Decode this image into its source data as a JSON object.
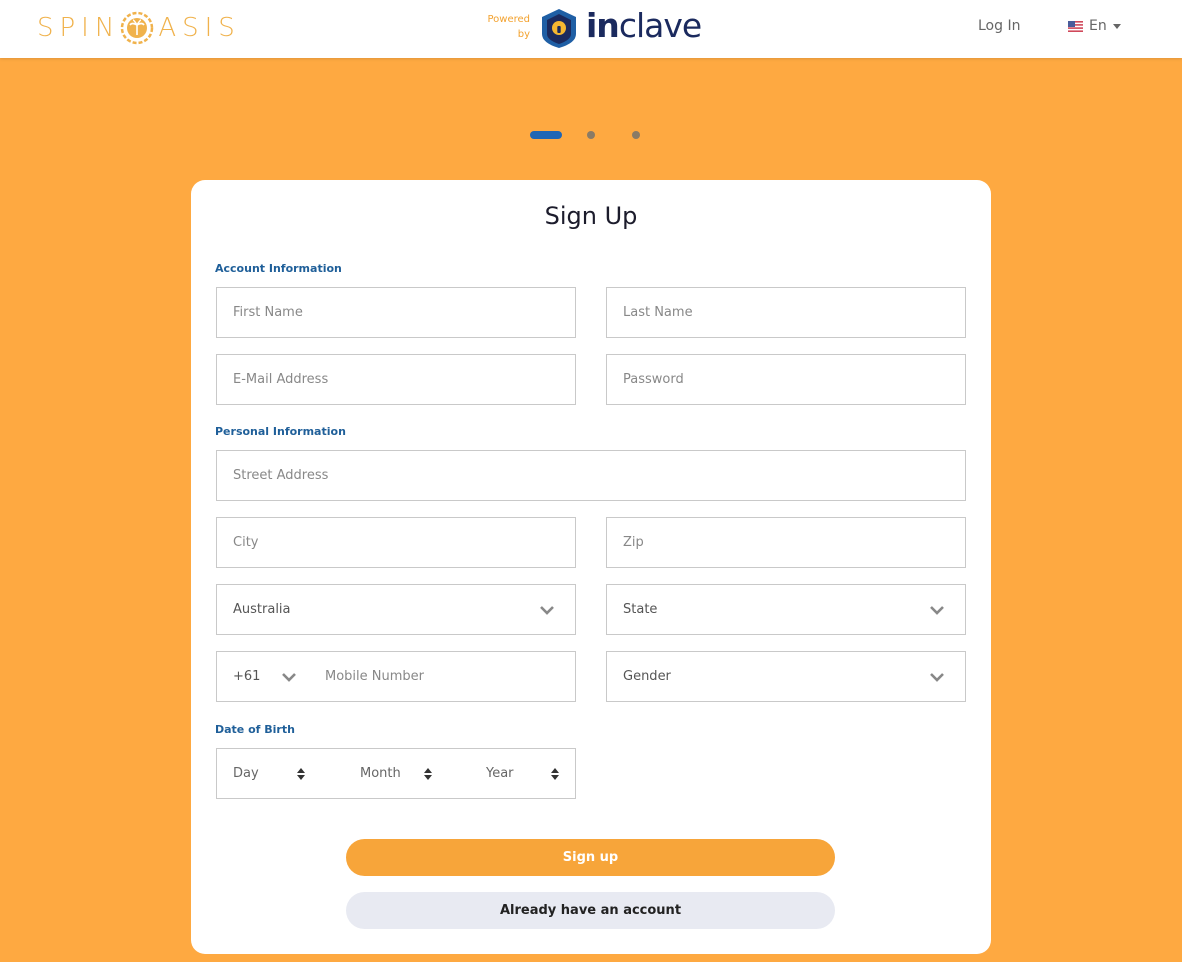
{
  "header": {
    "logo_left": "SPIN",
    "logo_right": "ASIS",
    "powered_line1": "Powered",
    "powered_line2": "by",
    "partner_in": "in",
    "partner_rest": "clave",
    "login_label": "Log In",
    "language_label": "En"
  },
  "stepper": {
    "total": 3,
    "active": 1
  },
  "form": {
    "title": "Sign Up",
    "sections": {
      "account": "Account Information",
      "personal": "Personal Information",
      "dob": "Date of Birth"
    },
    "first_name": "First Name",
    "last_name": "Last Name",
    "email": "E-Mail Address",
    "password": "Password",
    "street": "Street Address",
    "city": "City",
    "zip": "Zip",
    "country": "Australia",
    "state": "State",
    "phone_code": "+61",
    "mobile": "Mobile Number",
    "gender": "Gender",
    "day": "Day",
    "month": "Month",
    "year": "Year",
    "submit_label": "Sign up",
    "existing_label": "Already have an account"
  },
  "colors": {
    "background": "#fea941",
    "accent": "#f7a53a",
    "section_label": "#1f5f99",
    "active_step": "#1f66b5"
  }
}
